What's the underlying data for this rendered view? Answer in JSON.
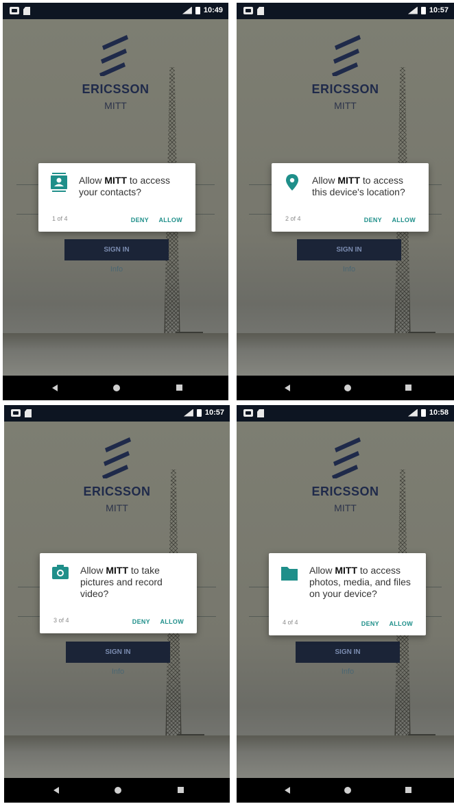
{
  "screens": [
    {
      "time": "10:49",
      "brand": "ERICSSON",
      "subtitle": "MITT",
      "signin": "SIGN IN",
      "info": "Info",
      "dialog": {
        "icon": "contacts-icon",
        "pre": "Allow ",
        "app": "MITT",
        "text": " to access your contacts?",
        "count": "1 of 4",
        "deny": "DENY",
        "allow": "ALLOW"
      }
    },
    {
      "time": "10:57",
      "brand": "ERICSSON",
      "subtitle": "MITT",
      "signin": "SIGN IN",
      "info": "Info",
      "dialog": {
        "icon": "location-pin-icon",
        "pre": "Allow ",
        "app": "MITT",
        "text": " to access this device's location?",
        "count": "2 of 4",
        "deny": "DENY",
        "allow": "ALLOW"
      }
    },
    {
      "time": "10:57",
      "brand": "ERICSSON",
      "subtitle": "MITT",
      "signin": "SIGN IN",
      "info": "Info",
      "dialog": {
        "icon": "camera-icon",
        "pre": "Allow ",
        "app": "MITT",
        "text": " to take pictures and record video?",
        "count": "3 of 4",
        "deny": "DENY",
        "allow": "ALLOW"
      }
    },
    {
      "time": "10:58",
      "brand": "ERICSSON",
      "subtitle": "MITT",
      "signin": "SIGN IN",
      "info": "Info",
      "dialog": {
        "icon": "folder-icon",
        "pre": "Allow ",
        "app": "MITT",
        "text": " to access photos, media, and files on your device?",
        "count": "4 of 4",
        "deny": "DENY",
        "allow": "ALLOW"
      }
    }
  ],
  "colors": {
    "accent": "#1f8f8a",
    "brand": "#1f2a4a",
    "statusbar": "#0d1522"
  }
}
